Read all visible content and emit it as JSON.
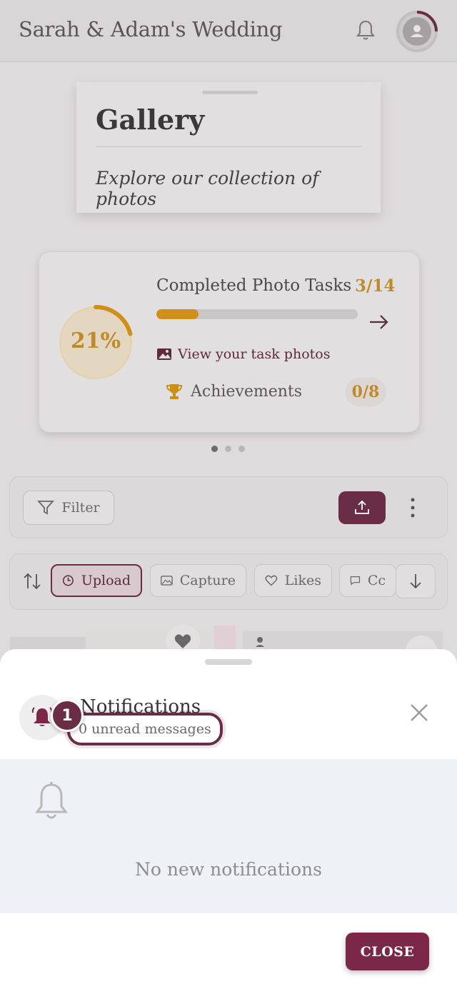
{
  "header": {
    "title": "Sarah & Adam's Wedding"
  },
  "gallery": {
    "title": "Gallery",
    "subtitle": "Explore our collection of photos"
  },
  "tasks": {
    "percent_label": "21%",
    "percent_value": 21,
    "title": "Completed Photo Tasks",
    "count": "3/14",
    "progress_fraction": 0.21,
    "view_photos_label": "View your task photos",
    "achievements_label": "Achievements",
    "achievements_count": "0/8"
  },
  "carousel": {
    "pages": 3,
    "active": 0
  },
  "toolbar": {
    "filter_label": "Filter"
  },
  "sort": {
    "chips": [
      {
        "label": "Upload",
        "icon": "clock-icon",
        "active": true
      },
      {
        "label": "Capture",
        "icon": "image-icon",
        "active": false
      },
      {
        "label": "Likes",
        "icon": "heart-icon",
        "active": false
      },
      {
        "label": "Cc",
        "icon": "comment-icon",
        "active": false
      }
    ]
  },
  "notifications": {
    "title": "Notifications",
    "unread_label": "0 unread messages",
    "badge": "1",
    "empty_text": "No new notifications",
    "close_label": "CLOSE"
  },
  "colors": {
    "accent": "#6a2d46",
    "gold": "#c08a2b",
    "close_button": "#7b2748"
  }
}
